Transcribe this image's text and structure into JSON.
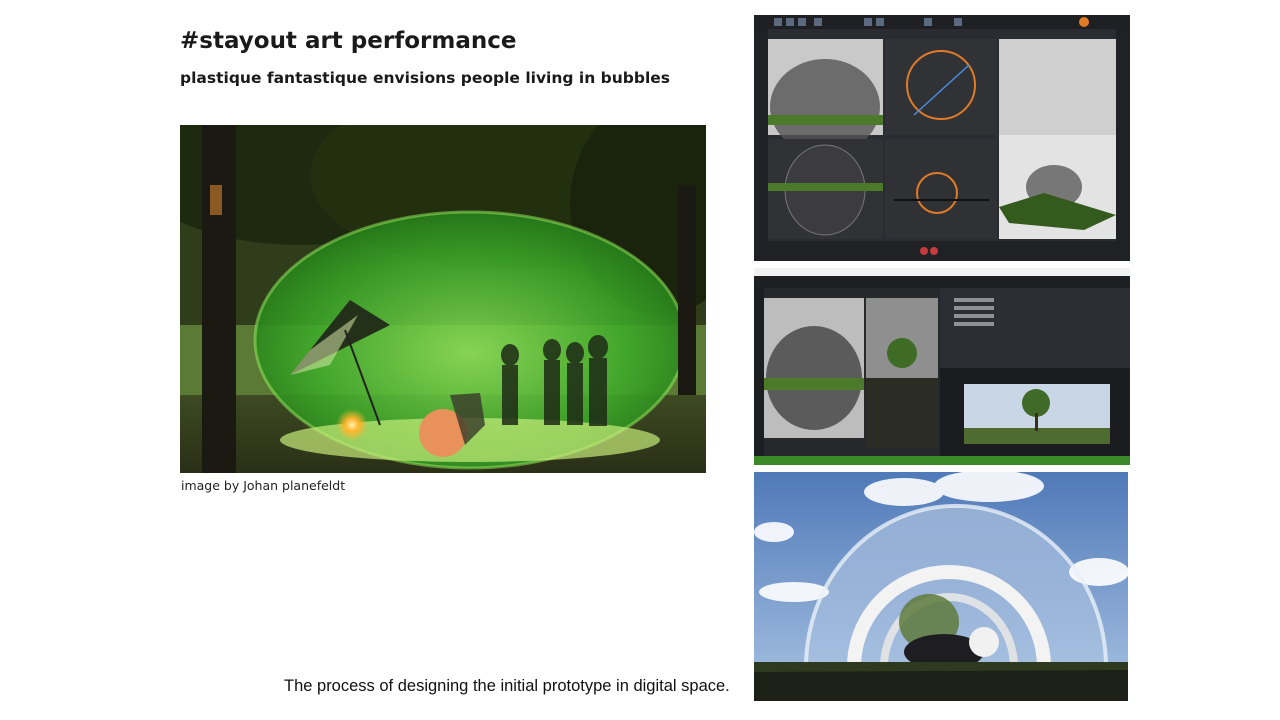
{
  "header": {
    "title": "#stayout art performance",
    "subtitle": "plastique fantastique envisions people living in bubbles"
  },
  "photo": {
    "credit": "image by Johan planefeldt"
  },
  "caption": "The process of designing the initial prototype in digital space.",
  "colors": {
    "bubble_green": "#3fae2a",
    "software_ui": "#2a2c31",
    "render_sky": "#6c90c4",
    "orange_accent": "#e07b26"
  },
  "icons": {
    "umbrella": "striped-umbrella",
    "ball": "orange-ball",
    "lamp": "glowing-lamp"
  }
}
